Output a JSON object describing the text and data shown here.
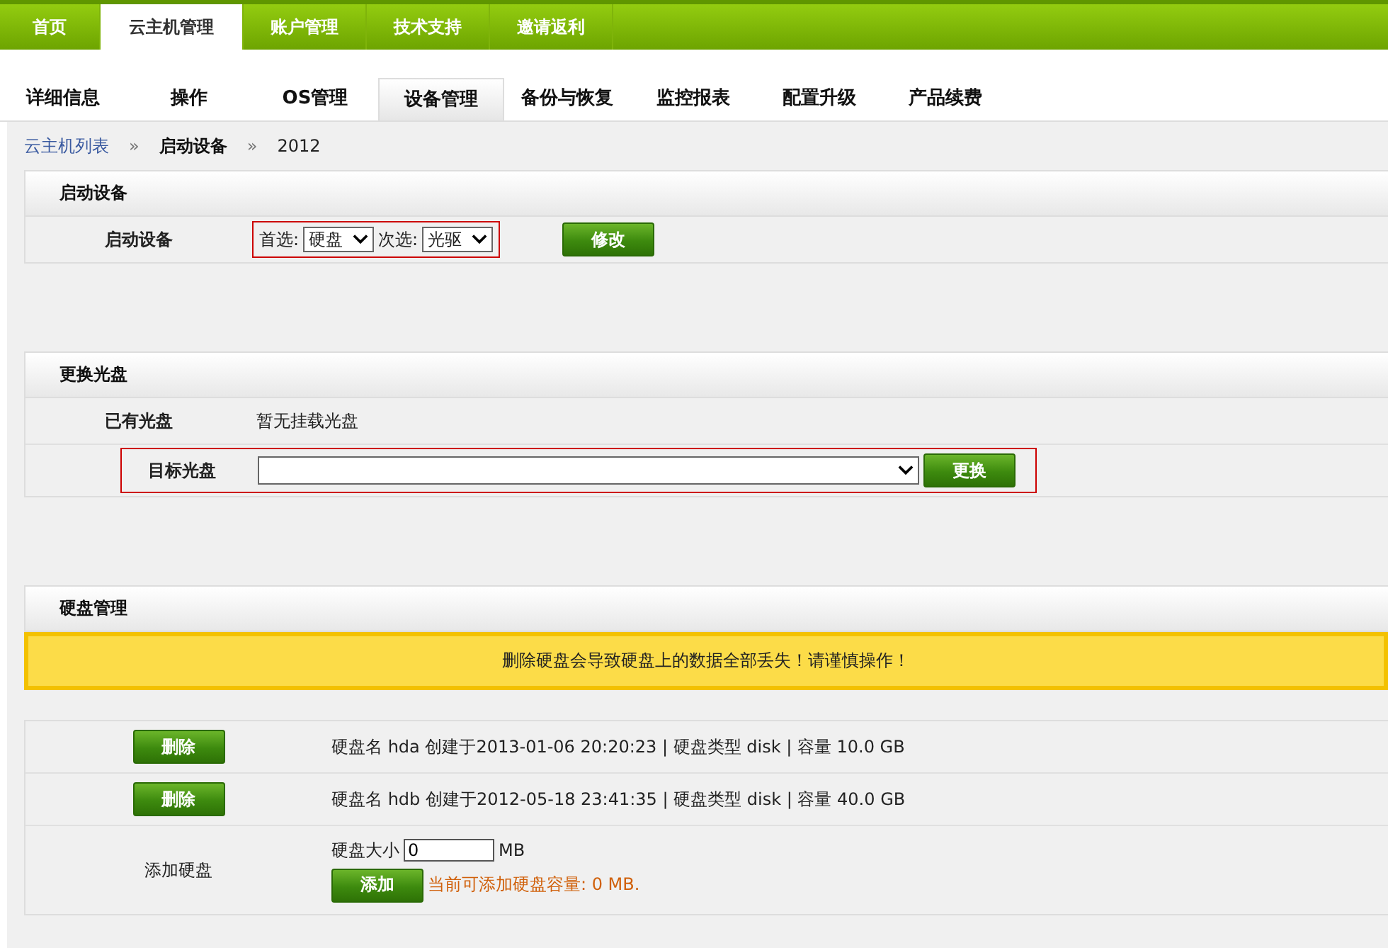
{
  "nav_tabs": [
    {
      "label": "首页",
      "selected": false
    },
    {
      "label": "云主机管理",
      "selected": true
    },
    {
      "label": "账户管理",
      "selected": false
    },
    {
      "label": "技术支持",
      "selected": false
    },
    {
      "label": "邀请返利",
      "selected": false
    }
  ],
  "sub_tabs": [
    {
      "label": "详细信息",
      "selected": false
    },
    {
      "label": "操作",
      "selected": false
    },
    {
      "label": "OS管理",
      "selected": false
    },
    {
      "label": "设备管理",
      "selected": true
    },
    {
      "label": "备份与恢复",
      "selected": false
    },
    {
      "label": "监控报表",
      "selected": false
    },
    {
      "label": "配置升级",
      "selected": false
    },
    {
      "label": "产品续费",
      "selected": false
    }
  ],
  "breadcrumb": [
    {
      "kind": "link",
      "label": "云主机列表"
    },
    {
      "kind": "separator",
      "label": "»"
    },
    {
      "kind": "current",
      "label": "启动设备"
    },
    {
      "kind": "separator",
      "label": "»"
    },
    {
      "kind": "text",
      "label": "2012"
    }
  ],
  "boot_section": {
    "title": "启动设备",
    "label": "启动设备",
    "highlighted": true,
    "primary_label": "首选:",
    "primary_value": "硬盘",
    "secondary_label": "次选:",
    "secondary_value": "光驱",
    "button": "修改"
  },
  "disc_section": {
    "title": "更换光盘",
    "current_label": "已有光盘",
    "current_value": "暂无挂载光盘",
    "target_label": "目标光盘",
    "highlighted": true,
    "button": "更换"
  },
  "disk_section": {
    "title": "硬盘管理",
    "warning": "删除硬盘会导致硬盘上的数据全部丢失！请谨慎操作！",
    "disks": [
      {
        "button": "删除",
        "info": "硬盘名 hda 创建于2013-01-06 20:20:23 | 硬盘类型 disk | 容量 10.0 GB"
      },
      {
        "button": "删除",
        "info": "硬盘名 hdb 创建于2012-05-18 23:41:35 | 硬盘类型 disk | 容量 40.0 GB"
      }
    ],
    "add": {
      "label": "添加硬盘",
      "size_label": "硬盘大小",
      "size_value": "0",
      "unit": "MB",
      "button": "添加",
      "note": "当前可添加硬盘容量: 0 MB."
    }
  }
}
